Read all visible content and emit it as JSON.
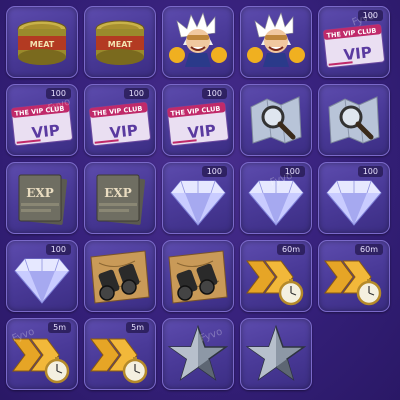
{
  "watermark": "Fyvo",
  "items": [
    {
      "type": "meat",
      "label": "MEAT",
      "qty": ""
    },
    {
      "type": "meat",
      "label": "MEAT",
      "qty": ""
    },
    {
      "type": "hero",
      "label": "",
      "qty": ""
    },
    {
      "type": "hero",
      "label": "",
      "qty": ""
    },
    {
      "type": "vip",
      "label": "VIP",
      "club": "THE VIP CLUB",
      "qty": "100"
    },
    {
      "type": "vip",
      "label": "VIP",
      "club": "THE VIP CLUB",
      "qty": "100"
    },
    {
      "type": "vip",
      "label": "VIP",
      "club": "THE VIP CLUB",
      "qty": "100"
    },
    {
      "type": "vip",
      "label": "VIP",
      "club": "THE VIP CLUB",
      "qty": "100"
    },
    {
      "type": "map",
      "label": "",
      "qty": ""
    },
    {
      "type": "map",
      "label": "",
      "qty": ""
    },
    {
      "type": "exp",
      "label": "EXP",
      "qty": ""
    },
    {
      "type": "exp",
      "label": "EXP",
      "qty": ""
    },
    {
      "type": "diamond",
      "label": "",
      "qty": "100"
    },
    {
      "type": "diamond",
      "label": "",
      "qty": "100"
    },
    {
      "type": "diamond",
      "label": "",
      "qty": "100"
    },
    {
      "type": "diamond",
      "label": "",
      "qty": "100"
    },
    {
      "type": "binoculars",
      "label": "",
      "qty": ""
    },
    {
      "type": "binoculars",
      "label": "",
      "qty": ""
    },
    {
      "type": "speedup",
      "label": "",
      "qty": "60m"
    },
    {
      "type": "speedup",
      "label": "",
      "qty": "60m"
    },
    {
      "type": "speedup",
      "label": "",
      "qty": "5m"
    },
    {
      "type": "speedup",
      "label": "",
      "qty": "5m"
    },
    {
      "type": "star",
      "label": "",
      "qty": ""
    },
    {
      "type": "star",
      "label": "",
      "qty": ""
    }
  ],
  "colors": {
    "background": "#35207a",
    "cell": "#4a3a98",
    "gold": "#e6a526",
    "diamond": "#c9ccff"
  }
}
